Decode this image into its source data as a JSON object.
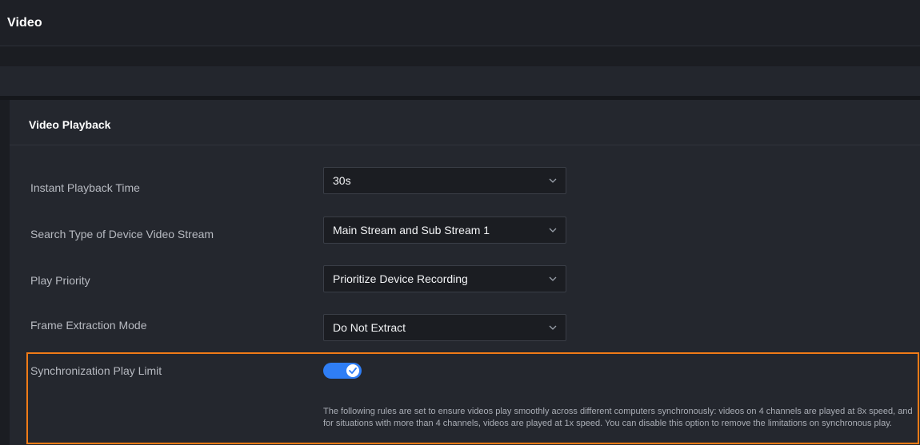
{
  "header": {
    "title": "Video"
  },
  "panel": {
    "title": "Video Playback",
    "rows": [
      {
        "label": "Instant Playback Time",
        "value": "30s"
      },
      {
        "label": "Search Type of Device Video Stream",
        "value": "Main Stream and Sub Stream 1"
      },
      {
        "label": "Play Priority",
        "value": "Prioritize Device Recording"
      },
      {
        "label": "Frame Extraction Mode",
        "value": "Do Not Extract"
      }
    ],
    "sync": {
      "label": "Synchronization Play Limit",
      "enabled": true,
      "hint": "The following rules are set to ensure videos play smoothly across different computers synchronously: videos on 4 channels are played at 8x speed, and for situations with more than 4 channels, videos are played at 1x speed. You can disable this option to remove the limitations on synchronous play."
    }
  },
  "colors": {
    "accent": "#2f7ef5",
    "highlight_border": "#f07b17",
    "background": "#1b1d22",
    "panel": "#24272e"
  },
  "icons": {
    "select_arrow": "chevron-down-icon",
    "toggle_check": "check-icon"
  }
}
